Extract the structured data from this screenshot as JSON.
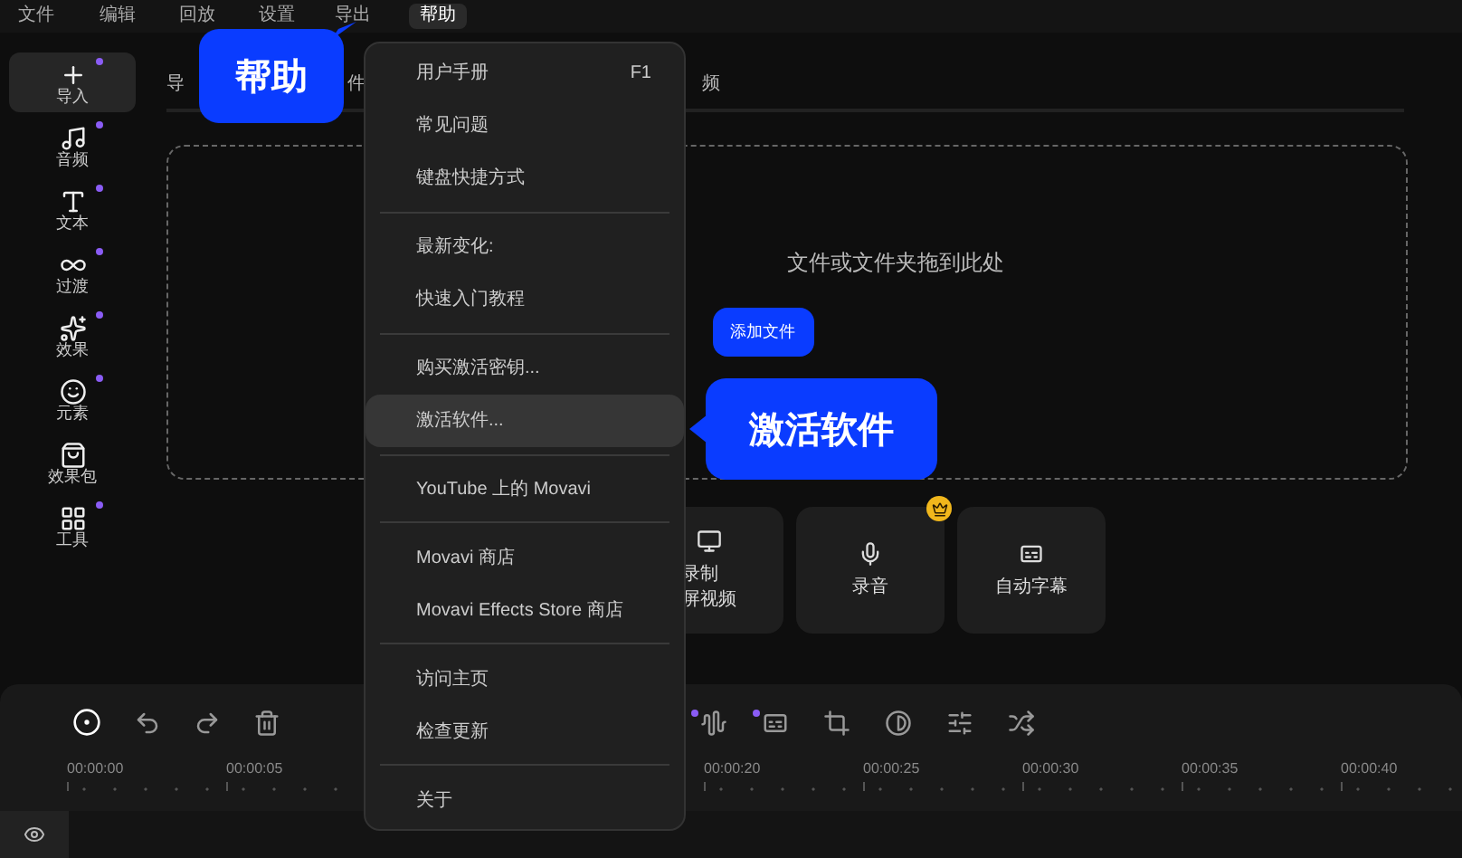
{
  "menu_bar": [
    {
      "label": "文件",
      "selected": false
    },
    {
      "label": "编辑",
      "selected": false
    },
    {
      "label": "回放",
      "selected": false
    },
    {
      "label": "设置",
      "selected": false
    },
    {
      "label": "导出",
      "selected": false
    },
    {
      "label": "帮助",
      "selected": true
    }
  ],
  "sidebar": {
    "items": [
      {
        "label": "导入",
        "selected": true,
        "new_dot": true
      },
      {
        "label": "音频",
        "selected": false,
        "new_dot": true
      },
      {
        "label": "文本",
        "selected": false,
        "new_dot": true
      },
      {
        "label": "过渡",
        "selected": false,
        "new_dot": true
      },
      {
        "label": "效果",
        "selected": false,
        "new_dot": true
      },
      {
        "label": "元素",
        "selected": false,
        "new_dot": true
      },
      {
        "label": "效果包",
        "selected": false,
        "new_dot": false
      },
      {
        "label": "工具",
        "selected": false,
        "new_dot": true
      }
    ]
  },
  "tabs": [
    {
      "label": "导"
    },
    {
      "label": "件"
    },
    {
      "label": "频"
    }
  ],
  "drop_zone": {
    "hint": "文件或文件夹拖到此处",
    "button": "添加文件"
  },
  "cards": [
    {
      "lines": [
        "录制",
        "屏视频"
      ],
      "premium": false
    },
    {
      "lines": [
        "录音"
      ],
      "premium": true
    },
    {
      "lines": [
        "自动字幕"
      ],
      "premium": false
    }
  ],
  "timeline": {
    "left_tools": [
      {
        "new_dot": false
      },
      {
        "new_dot": false
      },
      {
        "new_dot": false
      },
      {
        "new_dot": false
      }
    ],
    "right_tools": [
      {
        "new_dot": true
      },
      {
        "new_dot": true
      },
      {
        "new_dot": false
      },
      {
        "new_dot": false
      },
      {
        "new_dot": false
      },
      {
        "new_dot": false
      }
    ],
    "ticks_before_menu": [
      "00:00:00",
      "00:00:05"
    ],
    "ticks_after_menu": [
      "00:00:20",
      "00:00:25",
      "00:00:30",
      "00:00:35",
      "00:00:40"
    ]
  },
  "help_menu": {
    "groups": [
      [
        {
          "label": "用户手册",
          "shortcut": "F1",
          "selected": false
        },
        {
          "label": "常见问题",
          "selected": false
        },
        {
          "label": "键盘快捷方式",
          "selected": false
        }
      ],
      [
        {
          "label": "最新变化:",
          "selected": false
        },
        {
          "label": "快速入门教程",
          "selected": false
        }
      ],
      [
        {
          "label": "购买激活密钥...",
          "selected": false
        },
        {
          "label": "激活软件...",
          "selected": true
        }
      ],
      [
        {
          "label": "YouTube 上的 Movavi",
          "selected": false
        }
      ],
      [
        {
          "label": "Movavi 商店",
          "selected": false
        },
        {
          "label": "Movavi Effects Store 商店",
          "selected": false
        }
      ],
      [
        {
          "label": "访问主页",
          "selected": false
        },
        {
          "label": "检查更新",
          "selected": false
        }
      ],
      [
        {
          "label": "关于",
          "selected": false
        }
      ]
    ]
  },
  "callouts": [
    {
      "text": "帮助"
    },
    {
      "text": "激活软件"
    }
  ]
}
